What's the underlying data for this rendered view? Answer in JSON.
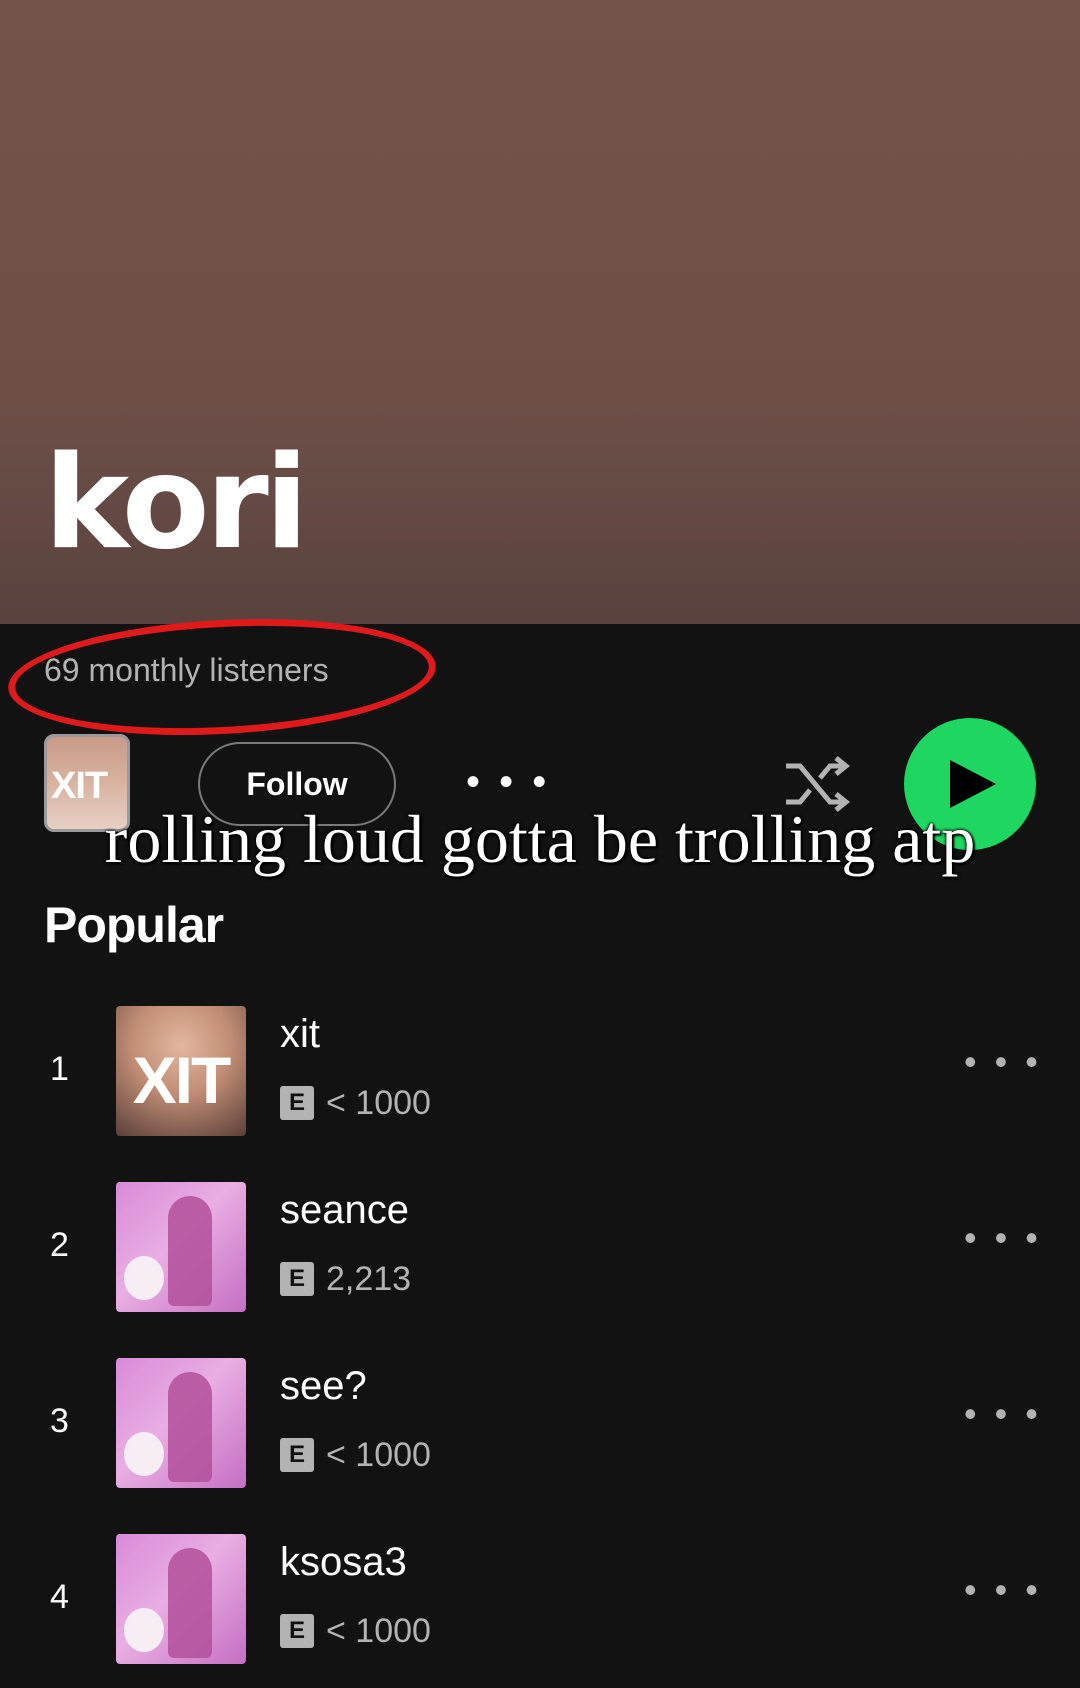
{
  "artist": {
    "name": "kori",
    "monthly_listeners": "69 monthly listeners",
    "thumb_text": "XIT"
  },
  "actions": {
    "follow_label": "Follow",
    "more_label": "• • •"
  },
  "caption": "rolling loud gotta be trolling atp",
  "popular": {
    "title": "Popular",
    "tracks": [
      {
        "num": "1",
        "title": "xit",
        "explicit": "E",
        "plays": "< 1000",
        "art": "XIT"
      },
      {
        "num": "2",
        "title": "seance",
        "explicit": "E",
        "plays": "2,213"
      },
      {
        "num": "3",
        "title": "see?",
        "explicit": "E",
        "plays": "< 1000"
      },
      {
        "num": "4",
        "title": "ksosa3",
        "explicit": "E",
        "plays": "< 1000"
      }
    ],
    "more_label": "• • •"
  },
  "colors": {
    "header": "#74534b",
    "background": "#121212",
    "play_button": "#1ed760",
    "annotation_circle": "#e0191b"
  }
}
